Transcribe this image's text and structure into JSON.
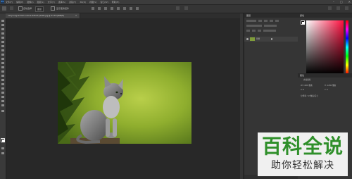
{
  "app": {
    "logo": "Ps"
  },
  "menubar": {
    "items": [
      "文件(F)",
      "编辑(E)",
      "图像(I)",
      "图层(L)",
      "文字(Y)",
      "选择(S)",
      "滤镜(T)",
      "3D(D)",
      "视图(V)",
      "窗口(W)",
      "帮助(H)"
    ],
    "window_buttons": [
      "–",
      "□",
      "✕"
    ]
  },
  "options": {
    "auto_select_label": "自动选择",
    "auto_select_value": "图层",
    "transform_label": "显示变换控件"
  },
  "document": {
    "tab_title": "cat-young-animal-curious-wildcat-pexels.jpg @ 33.3%(RGB/8)",
    "close": "×"
  },
  "layers": {
    "panel_title": "图层",
    "layer_name": "背景"
  },
  "color_panel": {
    "title": "颜色"
  },
  "properties": {
    "title": "属性",
    "doc_label": "文档属性",
    "w_label": "W: 1920 像素",
    "h_label": "H: 1280 像素",
    "x_label": "X: 0",
    "y_label": "Y: 0",
    "res_label": "分辨率: 72 像素/英寸"
  },
  "watermark": {
    "line1": "百科全说",
    "line2": "助你轻松解决"
  },
  "colors": {
    "menubar_bg": "#3c3c3c",
    "workspace_bg": "#282828",
    "panel_bg": "#353535",
    "watermark_green": "#2f8f2a"
  }
}
